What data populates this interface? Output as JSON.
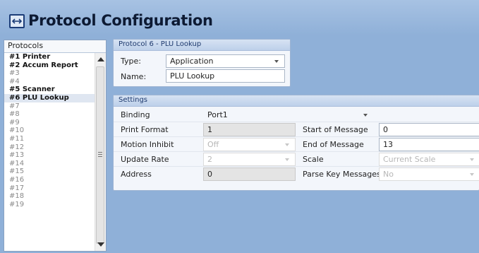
{
  "window": {
    "title": "Protocol Configuration",
    "icon": "swap-arrows-icon"
  },
  "protocols": {
    "header": "Protocols",
    "items": [
      {
        "label": "#1 Printer",
        "active": true
      },
      {
        "label": "#2 Accum Report",
        "active": true
      },
      {
        "label": "#3",
        "active": false
      },
      {
        "label": "#4",
        "active": false
      },
      {
        "label": "#5 Scanner",
        "active": true
      },
      {
        "label": "#6 PLU Lookup",
        "active": true,
        "selected": true
      },
      {
        "label": "#7",
        "active": false
      },
      {
        "label": "#8",
        "active": false
      },
      {
        "label": "#9",
        "active": false
      },
      {
        "label": "#10",
        "active": false
      },
      {
        "label": "#11",
        "active": false
      },
      {
        "label": "#12",
        "active": false
      },
      {
        "label": "#13",
        "active": false
      },
      {
        "label": "#14",
        "active": false
      },
      {
        "label": "#15",
        "active": false
      },
      {
        "label": "#16",
        "active": false
      },
      {
        "label": "#17",
        "active": false
      },
      {
        "label": "#18",
        "active": false
      },
      {
        "label": "#19",
        "active": false
      }
    ]
  },
  "protocol_group": {
    "header": "Protocol 6 - PLU Lookup",
    "type_label": "Type:",
    "type_value": "Application",
    "name_label": "Name:",
    "name_value": "PLU Lookup"
  },
  "settings": {
    "header": "Settings",
    "binding_label": "Binding",
    "binding_value": "Port1",
    "print_format_label": "Print Format",
    "print_format_value": "1",
    "motion_inhibit_label": "Motion Inhibit",
    "motion_inhibit_value": "Off",
    "update_rate_label": "Update Rate",
    "update_rate_value": "2",
    "address_label": "Address",
    "address_value": "0",
    "start_of_message_label": "Start of Message",
    "start_of_message_value": "0",
    "end_of_message_label": "End of Message",
    "end_of_message_value": "13",
    "scale_label": "Scale",
    "scale_value": "Current Scale",
    "parse_key_messages_label": "Parse Key Messages",
    "parse_key_messages_value": "No"
  }
}
